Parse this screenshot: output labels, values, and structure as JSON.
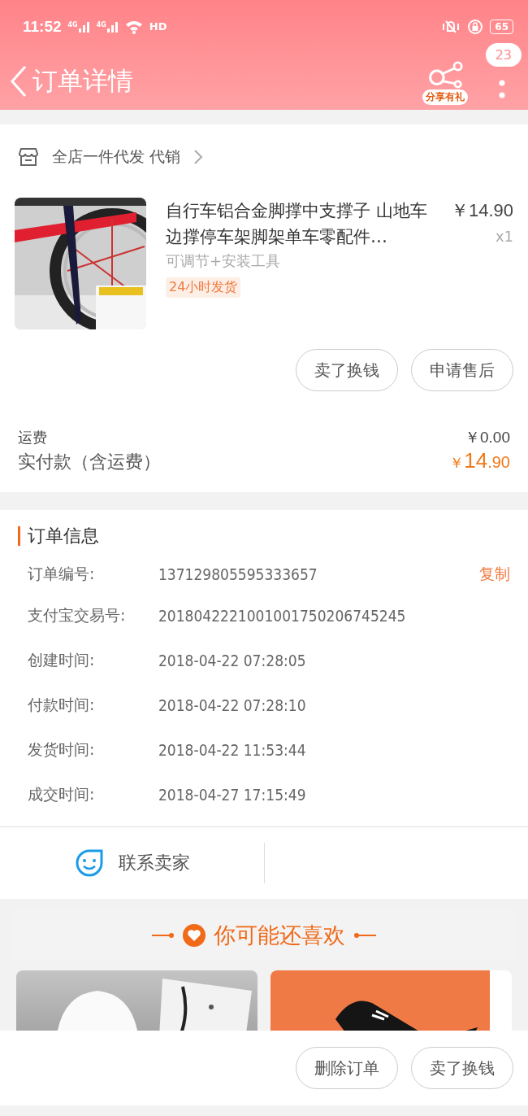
{
  "status_bar": {
    "time": "11:52",
    "network_labels": [
      "4G",
      "4G"
    ],
    "hd_label": "HD",
    "battery": "65"
  },
  "header": {
    "title": "订单详情",
    "share_label": "分享有礼",
    "badge": "23"
  },
  "shop": {
    "name": "全店一件代发 代销"
  },
  "product": {
    "title": "自行车铝合金脚撑中支撑子 山地车边撑停车架脚架单车零配件…",
    "price": "￥14.90",
    "quantity": "x1",
    "variant": "可调节+安装工具",
    "tag": "24小时发货"
  },
  "item_buttons": [
    "卖了换钱",
    "申请售后"
  ],
  "fees": [
    {
      "label": "运费",
      "value": "￥0.00",
      "kind": "plain"
    },
    {
      "label": "实付款（含运费）",
      "currency": "￥",
      "amount": "14",
      "cents": ".90",
      "kind": "total"
    }
  ],
  "order_info": {
    "title": "订单信息",
    "rows": [
      {
        "label": "订单编号:",
        "value": "137129805595333657",
        "action": "复制"
      },
      {
        "label": "支付宝交易号:",
        "value": "2018042221001001750206745245"
      },
      {
        "label": "创建时间:",
        "value": "2018-04-22 07:28:05"
      },
      {
        "label": "付款时间:",
        "value": "2018-04-22 07:28:10"
      },
      {
        "label": "发货时间:",
        "value": "2018-04-22 11:53:44"
      },
      {
        "label": "成交时间:",
        "value": "2018-04-27 17:15:49"
      }
    ]
  },
  "contact": {
    "label": "联系卖家"
  },
  "recommend": {
    "title": "你可能还喜欢"
  },
  "bottom_buttons": [
    "删除订单",
    "卖了换钱"
  ]
}
